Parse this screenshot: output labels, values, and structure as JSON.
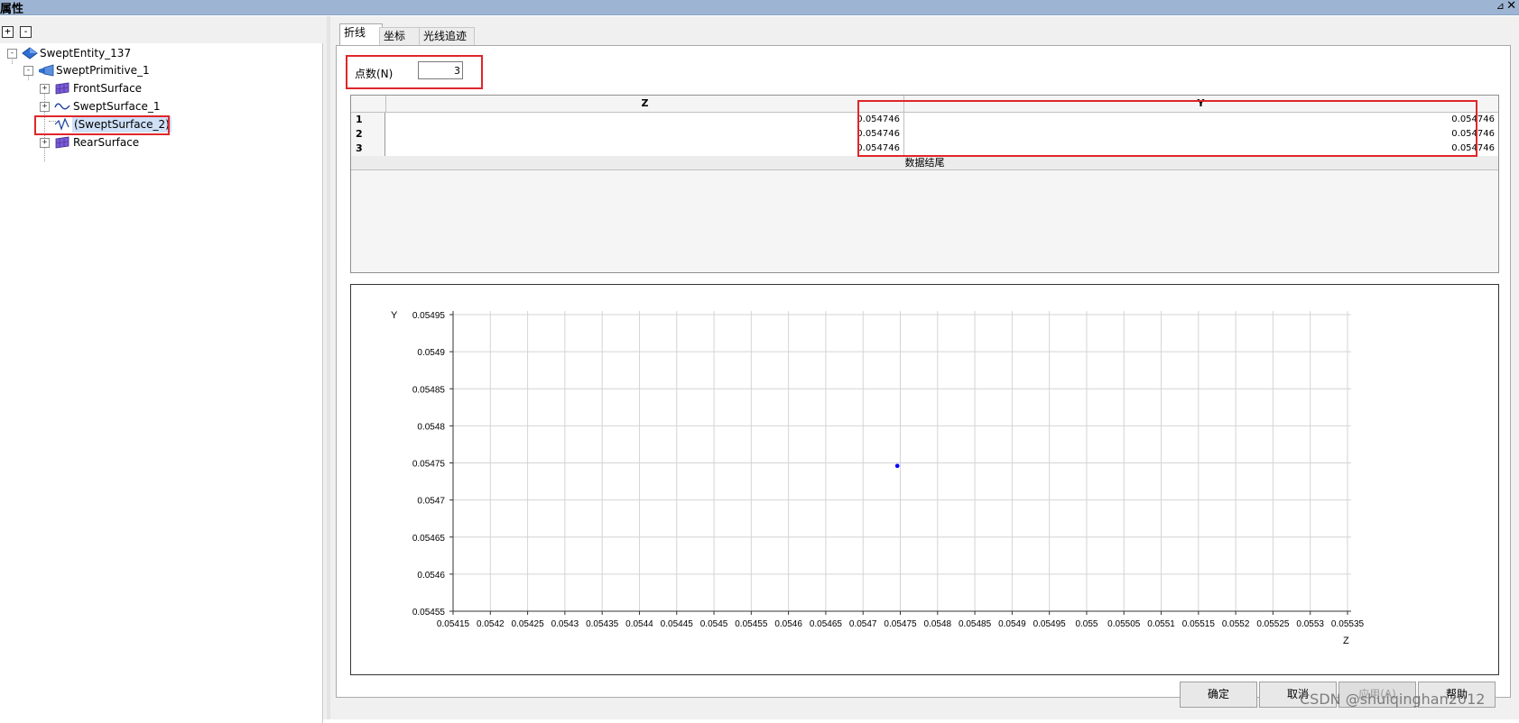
{
  "window": {
    "title": "属性",
    "pin_glyph": "⊿",
    "close_glyph": "✕"
  },
  "tree_toolbar": {
    "expand_all": "+",
    "collapse_all": "-"
  },
  "tree": {
    "root": {
      "label": "SweptEntity_137",
      "expander": "-"
    },
    "primitive": {
      "label": "SweptPrimitive_1",
      "expander": "-"
    },
    "children": [
      {
        "label": "FrontSurface",
        "expander": "+",
        "icon": "surface-icon"
      },
      {
        "label": "SweptSurface_1",
        "expander": "+",
        "icon": "curve-icon"
      },
      {
        "label": "(SweptSurface_2)",
        "expander": "",
        "icon": "curve-icon",
        "selected": true
      },
      {
        "label": "RearSurface",
        "expander": "+",
        "icon": "surface-icon"
      }
    ]
  },
  "tabs": [
    {
      "label": "折线",
      "active": true
    },
    {
      "label": "坐标",
      "active": false
    },
    {
      "label": "光线追迹",
      "active": false
    }
  ],
  "points": {
    "label": "点数(N)",
    "value": "3"
  },
  "table": {
    "columns": [
      "Z",
      "Y"
    ],
    "rows": [
      {
        "index": "1",
        "z": "0.054746",
        "y": "0.054746"
      },
      {
        "index": "2",
        "z": "0.054746",
        "y": "0.054746"
      },
      {
        "index": "3",
        "z": "0.054746",
        "y": "0.054746"
      }
    ],
    "end_label": "数据结尾"
  },
  "chart_data": {
    "type": "scatter",
    "xlabel": "Z",
    "ylabel": "Y",
    "xlim": [
      0.05415,
      0.05535
    ],
    "ylim": [
      0.05455,
      0.05495
    ],
    "x_ticks": [
      "0.05415",
      "0.0542",
      "0.05425",
      "0.0543",
      "0.05435",
      "0.0544",
      "0.05445",
      "0.0545",
      "0.05455",
      "0.0546",
      "0.05465",
      "0.0547",
      "0.05475",
      "0.0548",
      "0.05485",
      "0.0549",
      "0.05495",
      "0.055",
      "0.05505",
      "0.0551",
      "0.05515",
      "0.0552",
      "0.05525",
      "0.0553",
      "0.05535"
    ],
    "y_ticks": [
      "0.05495",
      "0.0549",
      "0.05485",
      "0.0548",
      "0.05475",
      "0.0547",
      "0.05465",
      "0.0546",
      "0.05455"
    ],
    "points": [
      {
        "x": 0.054746,
        "y": 0.054746
      },
      {
        "x": 0.054746,
        "y": 0.054746
      },
      {
        "x": 0.054746,
        "y": 0.054746
      }
    ],
    "grid": true,
    "point_color": "#0000ff"
  },
  "footer": {
    "ok": "确定",
    "cancel": "取消",
    "apply": "应用(A)",
    "help": "帮助"
  },
  "watermark": "CSDN @shuiqinghan2012",
  "colors": {
    "highlight": "#e0262a",
    "titlebar": "#9db5d3",
    "point": "#0000ff"
  }
}
